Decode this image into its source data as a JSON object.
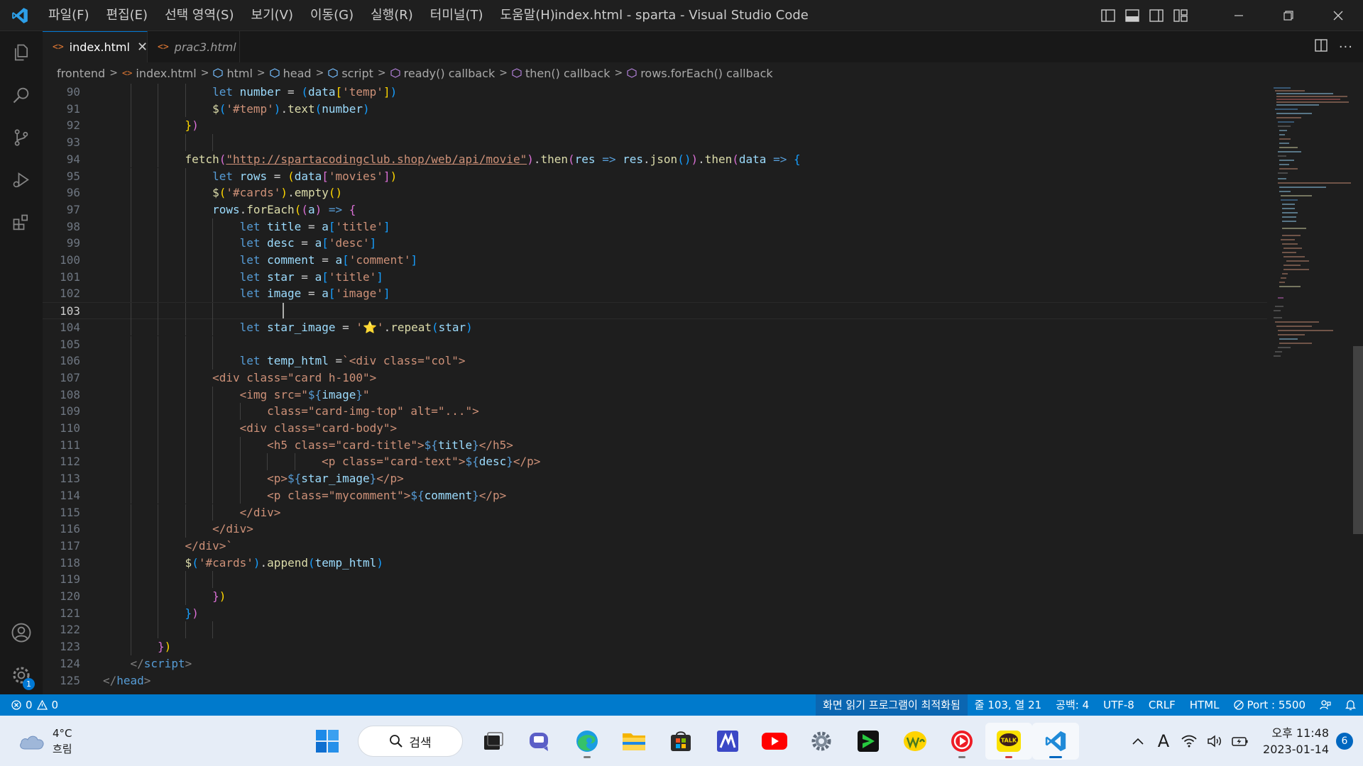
{
  "window": {
    "title": "index.html - sparta - Visual Studio Code",
    "menu": [
      "파일(F)",
      "편집(E)",
      "선택 영역(S)",
      "보기(V)",
      "이동(G)",
      "실행(R)",
      "터미널(T)",
      "도움말(H)"
    ]
  },
  "tabs": [
    {
      "label": "index.html",
      "active": true
    },
    {
      "label": "prac3.html",
      "active": false
    }
  ],
  "breadcrumb": [
    "frontend",
    "index.html",
    "html",
    "head",
    "script",
    "ready() callback",
    "then() callback",
    "rows.forEach() callback"
  ],
  "editor": {
    "current_line": 103,
    "lines": [
      {
        "n": 90,
        "indent": 4,
        "html": "<span class=\"kw\">let</span> <span class=\"vr\">number</span> = <span class=\"br3\">(</span><span class=\"vr\">data</span><span class=\"br1\">[</span><span class=\"st\">'temp'</span><span class=\"br1\">]</span><span class=\"br3\">)</span>"
      },
      {
        "n": 91,
        "indent": 4,
        "html": "<span class=\"fn\">$</span><span class=\"br3\">(</span><span class=\"st\">'#temp'</span><span class=\"br3\">)</span>.<span class=\"fn\">text</span><span class=\"br3\">(</span><span class=\"vr\">number</span><span class=\"br3\">)</span>"
      },
      {
        "n": 92,
        "indent": 3,
        "html": "<span class=\"br1\">}</span><span class=\"br2\">)</span>"
      },
      {
        "n": 93,
        "indent": 0,
        "html": ""
      },
      {
        "n": 94,
        "indent": 3,
        "html": "<span class=\"fn\">fetch</span><span class=\"br2\">(</span><span class=\"st ul\">\"http://spartacodingclub.shop/web/api/movie\"</span><span class=\"br2\">)</span>.<span class=\"fn\">then</span><span class=\"br2\">(</span><span class=\"vr\">res</span> <span class=\"kw\">=&gt;</span> <span class=\"vr\">res</span>.<span class=\"fn\">json</span><span class=\"br3\">()</span><span class=\"br2\">)</span>.<span class=\"fn\">then</span><span class=\"br2\">(</span><span class=\"vr\">data</span> <span class=\"kw\">=&gt;</span> <span class=\"br3\">{</span>"
      },
      {
        "n": 95,
        "indent": 4,
        "html": "<span class=\"kw\">let</span> <span class=\"vr\">rows</span> = <span class=\"br1\">(</span><span class=\"vr\">data</span><span class=\"br2\">[</span><span class=\"st\">'movies'</span><span class=\"br2\">]</span><span class=\"br1\">)</span>"
      },
      {
        "n": 96,
        "indent": 4,
        "html": "<span class=\"fn\">$</span><span class=\"br1\">(</span><span class=\"st\">'#cards'</span><span class=\"br1\">)</span>.<span class=\"fn\">empty</span><span class=\"br1\">()</span>"
      },
      {
        "n": 97,
        "indent": 4,
        "html": "<span class=\"vr\">rows</span>.<span class=\"fn\">forEach</span><span class=\"br1\">(</span><span class=\"br2\">(</span><span class=\"vr\">a</span><span class=\"br2\">)</span> <span class=\"kw\">=&gt;</span> <span class=\"br2\">{</span>"
      },
      {
        "n": 98,
        "indent": 5,
        "html": "<span class=\"kw\">let</span> <span class=\"vr\">title</span> = <span class=\"vr\">a</span><span class=\"br3\">[</span><span class=\"st\">'title'</span><span class=\"br3\">]</span>"
      },
      {
        "n": 99,
        "indent": 5,
        "html": "<span class=\"kw\">let</span> <span class=\"vr\">desc</span> = <span class=\"vr\">a</span><span class=\"br3\">[</span><span class=\"st\">'desc'</span><span class=\"br3\">]</span>"
      },
      {
        "n": 100,
        "indent": 5,
        "html": "<span class=\"kw\">let</span> <span class=\"vr\">comment</span> = <span class=\"vr\">a</span><span class=\"br3\">[</span><span class=\"st\">'comment'</span><span class=\"br3\">]</span>"
      },
      {
        "n": 101,
        "indent": 5,
        "html": "<span class=\"kw\">let</span> <span class=\"vr\">star</span> = <span class=\"vr\">a</span><span class=\"br3\">[</span><span class=\"st\">'title'</span><span class=\"br3\">]</span>"
      },
      {
        "n": 102,
        "indent": 5,
        "html": "<span class=\"kw\">let</span> <span class=\"vr\">image</span> = <span class=\"vr\">a</span><span class=\"br3\">[</span><span class=\"st\">'image'</span><span class=\"br3\">]</span>"
      },
      {
        "n": 103,
        "indent": 0,
        "html": ""
      },
      {
        "n": 104,
        "indent": 5,
        "html": "<span class=\"kw\">let</span> <span class=\"vr\">star_image</span> = <span class=\"st\">'⭐'</span>.<span class=\"fn\">repeat</span><span class=\"br3\">(</span><span class=\"vr\">star</span><span class=\"br3\">)</span>"
      },
      {
        "n": 105,
        "indent": 0,
        "html": ""
      },
      {
        "n": 106,
        "indent": 5,
        "html": "<span class=\"kw\">let</span> <span class=\"vr\">temp_html</span> =<span class=\"st\">`&lt;div class=\"col\"&gt;</span>"
      },
      {
        "n": 107,
        "indent": 4,
        "html": "<span class=\"st\">&lt;div class=\"card h-100\"&gt;</span>"
      },
      {
        "n": 108,
        "indent": 5,
        "html": "<span class=\"st\">&lt;img src=\"</span><span class=\"kw\">${</span><span class=\"vr\">image</span><span class=\"kw\">}</span><span class=\"st\">\"</span>"
      },
      {
        "n": 109,
        "indent": 6,
        "html": "<span class=\"st\">class=\"card-img-top\" alt=\"...\"&gt;</span>"
      },
      {
        "n": 110,
        "indent": 5,
        "html": "<span class=\"st\">&lt;div class=\"card-body\"&gt;</span>"
      },
      {
        "n": 111,
        "indent": 6,
        "html": "<span class=\"st\">&lt;h5 class=\"card-title\"&gt;</span><span class=\"kw\">${</span><span class=\"vr\">title</span><span class=\"kw\">}</span><span class=\"st\">&lt;/h5&gt;</span>"
      },
      {
        "n": 112,
        "indent": 8,
        "html": "<span class=\"st\">&lt;p class=\"card-text\"&gt;</span><span class=\"kw\">${</span><span class=\"vr\">desc</span><span class=\"kw\">}</span><span class=\"st\">&lt;/p&gt;</span>"
      },
      {
        "n": 113,
        "indent": 6,
        "html": "<span class=\"st\">&lt;p&gt;</span><span class=\"kw\">${</span><span class=\"vr\">star_image</span><span class=\"kw\">}</span><span class=\"st\">&lt;/p&gt;</span>"
      },
      {
        "n": 114,
        "indent": 6,
        "html": "<span class=\"st\">&lt;p class=\"mycomment\"&gt;</span><span class=\"kw\">${</span><span class=\"vr\">comment</span><span class=\"kw\">}</span><span class=\"st\">&lt;/p&gt;</span>"
      },
      {
        "n": 115,
        "indent": 5,
        "html": "<span class=\"st\">&lt;/div&gt;</span>"
      },
      {
        "n": 116,
        "indent": 4,
        "html": "<span class=\"st\">&lt;/div&gt;</span>"
      },
      {
        "n": 117,
        "indent": 3,
        "html": "<span class=\"st\">&lt;/div&gt;`</span>"
      },
      {
        "n": 118,
        "indent": 3,
        "html": "<span class=\"fn\">$</span><span class=\"br3\">(</span><span class=\"st\">'#cards'</span><span class=\"br3\">)</span>.<span class=\"fn\">append</span><span class=\"br3\">(</span><span class=\"vr\">temp_html</span><span class=\"br3\">)</span>"
      },
      {
        "n": 119,
        "indent": 0,
        "html": ""
      },
      {
        "n": 120,
        "indent": 4,
        "html": "<span class=\"br2\">}</span><span class=\"br1\">)</span>"
      },
      {
        "n": 121,
        "indent": 3,
        "html": "<span class=\"br3\">}</span><span class=\"br2\">)</span>"
      },
      {
        "n": 122,
        "indent": 0,
        "html": ""
      },
      {
        "n": 123,
        "indent": 2,
        "html": "<span class=\"br2\">}</span><span class=\"br1\">)</span>"
      },
      {
        "n": 124,
        "indent": 1,
        "html": "<span class=\"tg\">&lt;/</span><span class=\"tn\">script</span><span class=\"tg\">&gt;</span>"
      },
      {
        "n": 125,
        "indent": 0,
        "html": "<span class=\"tg\">&lt;/</span><span class=\"tn\">head</span><span class=\"tg\">&gt;</span>"
      }
    ]
  },
  "statusbar": {
    "errors": "0",
    "warnings": "0",
    "screen_reader": "화면 읽기 프로그램이 최적화됨",
    "position": "줄 103, 열 21",
    "spaces": "공백: 4",
    "encoding": "UTF-8",
    "eol": "CRLF",
    "language": "HTML",
    "port": "Port : 5500"
  },
  "activity_badge": "1",
  "taskbar": {
    "temperature": "4°C",
    "weather": "흐림",
    "search_label": "검색",
    "time": "오후 11:48",
    "date": "2023-01-14",
    "notifications": "6",
    "ime": "A"
  },
  "colors": {
    "accent": "#007acc",
    "editor_bg": "#1e1e1e",
    "keyword": "#569cd6",
    "string": "#ce9178",
    "function": "#dcdcaa",
    "variable": "#9cdcfe"
  }
}
